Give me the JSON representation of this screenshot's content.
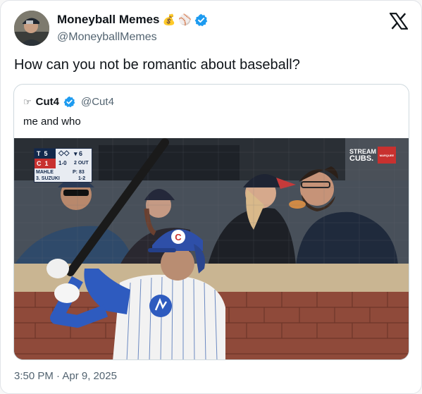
{
  "author": {
    "name": "Moneyball Memes",
    "handle": "@MoneyballMemes",
    "emoji": "💰⚾",
    "verified_color": "#1d9bf0"
  },
  "tweet": {
    "text": "How can you not be romantic about baseball?",
    "timestamp": "3:50 PM · Apr 9, 2025"
  },
  "quoted": {
    "name": "Cut4",
    "handle": "@Cut4",
    "text": "me and who"
  },
  "scorebug": {
    "team1": "T",
    "score1": "5",
    "team2": "C",
    "score2": "1",
    "inning": "▾ 6",
    "count": "1-0",
    "outs": "2 OUT",
    "pitcher": "MAHLE",
    "pitch_count": "P: 83",
    "batter": "3. SUZUKI",
    "batter_line": "1-2"
  },
  "broadcast": {
    "stream_line1": "STREAM",
    "stream_line2": "CUBS.",
    "logo_text": "MARQUEE"
  },
  "icons": [
    "verified-icon",
    "x-logo-icon",
    "money-bag-icon",
    "baseball-icon",
    "finger-point-icon"
  ]
}
